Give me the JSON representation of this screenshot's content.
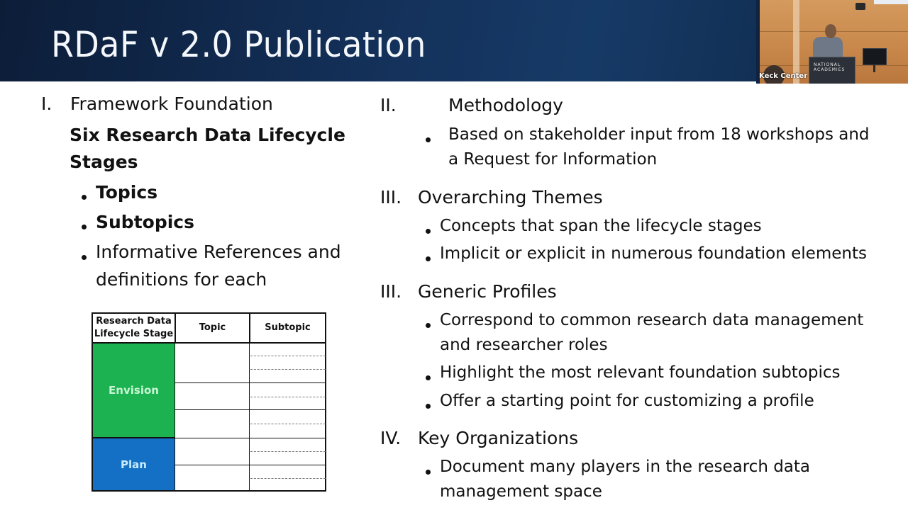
{
  "slide": {
    "title": "RDaF v 2.0 Publication",
    "colors": {
      "header_bg": "#14325c",
      "title_text": "#f4f7fb",
      "envision_green": "#1db251",
      "envision_text": "#c8f7d4",
      "plan_blue": "#1470c4",
      "plan_text": "#c9ecff"
    }
  },
  "video_inset": {
    "caption": "Keck Center",
    "podium_text": "NATIONAL ACADEMIES"
  },
  "left_column": {
    "section_roman": "I.",
    "section_title": "Framework Foundation",
    "bold_heading_line1": "Six Research Data Lifecycle",
    "bold_heading_line2": "Stages",
    "bullets": [
      {
        "text": "Topics",
        "bold": true
      },
      {
        "text": "Subtopics",
        "bold": true
      },
      {
        "text_line1": "Informative References and",
        "text_line2": "definitions for each",
        "bold": false
      }
    ]
  },
  "table": {
    "headers": [
      "Research Data Lifecycle Stage",
      "Topic",
      "Subtopic"
    ],
    "header_line1": "Research Data",
    "header_line2": "Lifecycle Stage",
    "stages": [
      {
        "name": "Envision",
        "topic_rows": 3,
        "subtopic_dividers_per_topic": [
          2,
          1,
          1
        ]
      },
      {
        "name": "Plan",
        "topic_rows": 2,
        "subtopic_dividers_per_topic": [
          1,
          1
        ]
      }
    ]
  },
  "right_column": {
    "sections": [
      {
        "roman": "II.",
        "title": "Methodology",
        "bullets": [
          {
            "line1": "Based on stakeholder input from 18 workshops and",
            "line2": "a Request for Information"
          }
        ]
      },
      {
        "roman": "III.",
        "title": "Overarching Themes",
        "bullets": [
          {
            "line1": "Concepts that span the lifecycle stages"
          },
          {
            "line1": "Implicit or explicit in numerous foundation elements"
          }
        ]
      },
      {
        "roman": "III.",
        "title": "Generic Profiles",
        "bullets": [
          {
            "line1": "Correspond to common research data management",
            "line2": "and researcher roles"
          },
          {
            "line1": "Highlight the most relevant foundation subtopics"
          },
          {
            "line1": "Offer a starting point for customizing a profile"
          }
        ]
      },
      {
        "roman": "IV.",
        "title": "Key Organizations",
        "bullets": [
          {
            "line1": "Document many players in the research data",
            "line2": "management space"
          }
        ]
      }
    ]
  }
}
